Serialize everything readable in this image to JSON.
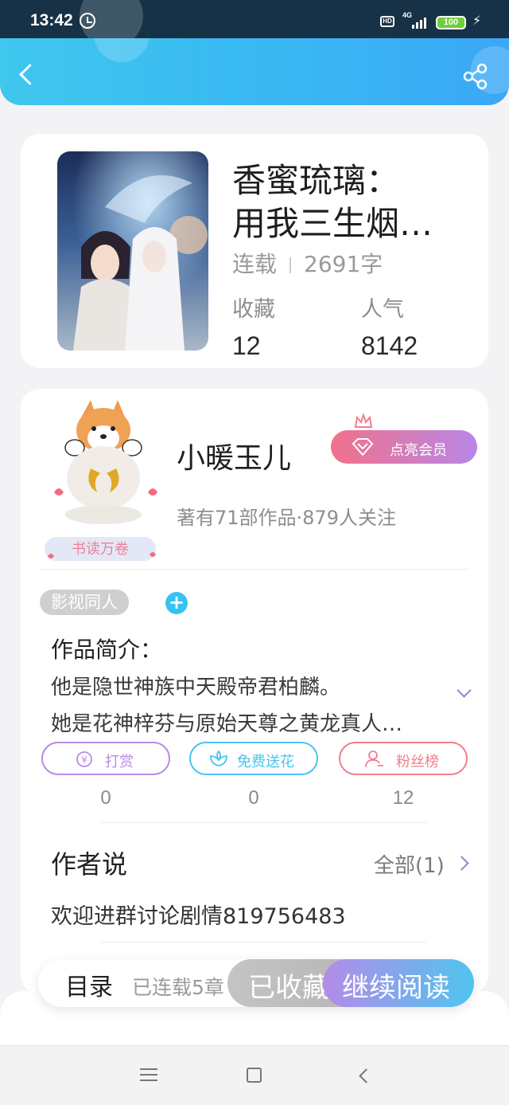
{
  "status_bar": {
    "time": "13:42",
    "network": "4G",
    "hd_badge": "HD",
    "battery": "100"
  },
  "book": {
    "title_line1": "香蜜琉璃：",
    "title_line2": "用我三生烟…",
    "status": "连载",
    "word_count": "2691字",
    "favorites_label": "收藏",
    "favorites_value": "12",
    "popularity_label": "人气",
    "popularity_value": "8142"
  },
  "author": {
    "name": "小暖玉儿",
    "stats": "著有71部作品·879人关注",
    "vip_button": "点亮会员",
    "avatar_badge": "书读万卷"
  },
  "tags": [
    "影视同人"
  ],
  "intro": {
    "title": "作品简介：",
    "line1": "他是隐世神族中天殿帝君柏麟。",
    "line2": "她是花神梓芬与原始天尊之黄龙真人…"
  },
  "actions": [
    {
      "label": "打赏",
      "count": "0",
      "color": "#b68ce3",
      "icon": "coin-icon"
    },
    {
      "label": "免费送花",
      "count": "0",
      "color": "#49c4ee",
      "icon": "flower-icon"
    },
    {
      "label": "粉丝榜",
      "count": "12",
      "color": "#f07f8c",
      "icon": "fan-icon"
    }
  ],
  "author_says": {
    "title": "作者说",
    "all_link": "全部(1)",
    "note": "欢迎进群讨论剧情819756483"
  },
  "bottom_bar": {
    "toc_label": "目录",
    "progress": "已连载5章",
    "favorited": "已收藏",
    "continue_reading": "继续阅读"
  },
  "colors": {
    "header_start": "#3fc7ee",
    "header_end": "#3ba7f6",
    "accent_purple": "#a57ad6",
    "vip_start": "#f1718a",
    "vip_end": "#b887e8"
  }
}
